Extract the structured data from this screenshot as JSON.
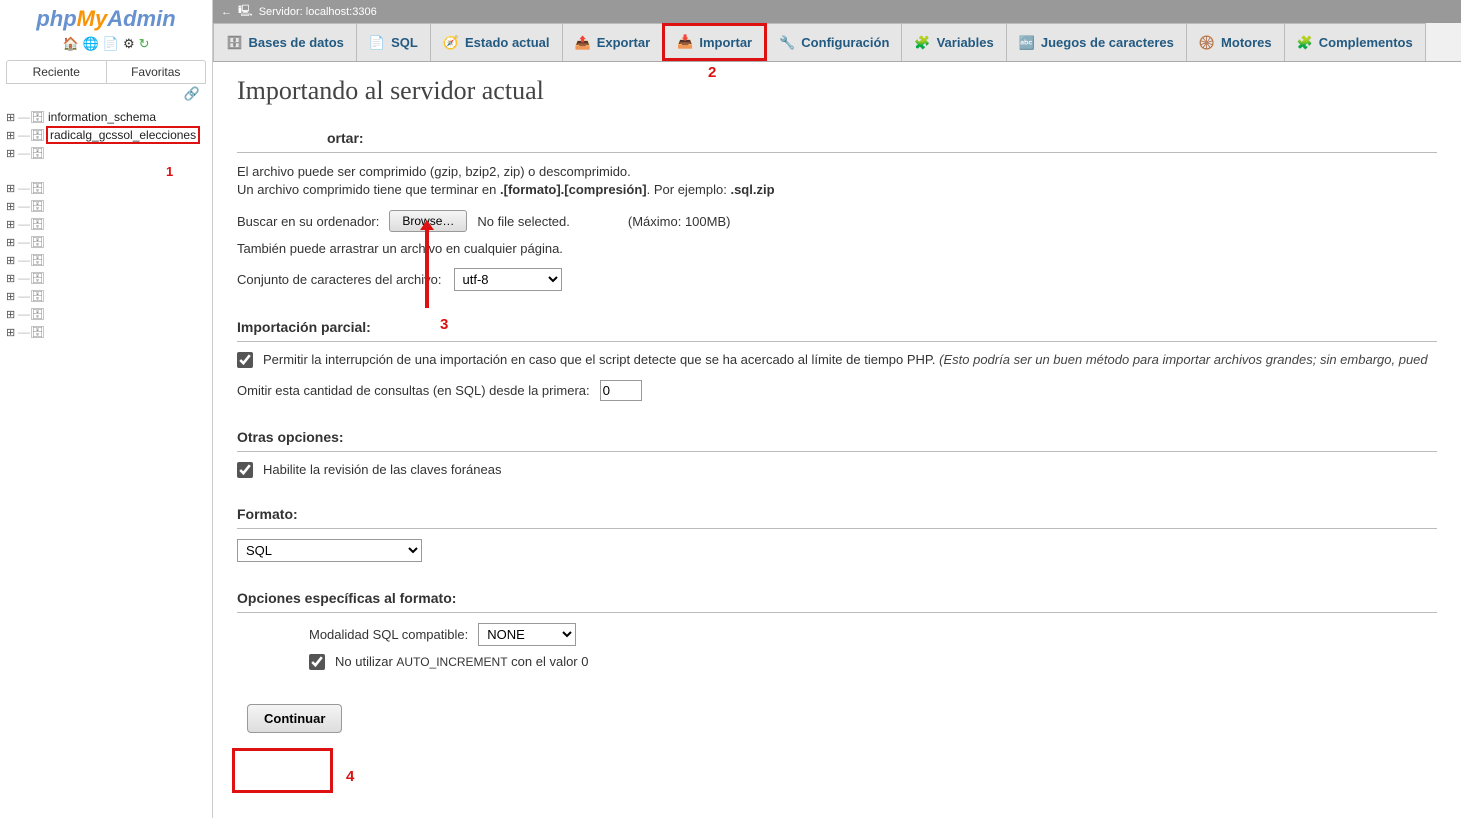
{
  "logo": {
    "p1": "php",
    "p2": "My",
    "p3": "Admin"
  },
  "sidebar_tabs": {
    "recent": "Reciente",
    "fav": "Favoritas"
  },
  "tree": {
    "db1": "information_schema",
    "db2": "radicalg_gcssol_elecciones"
  },
  "anno": {
    "one": "1",
    "two": "2",
    "three": "3",
    "four": "4"
  },
  "topbar": {
    "label": "Servidor: localhost:3306"
  },
  "tabs": {
    "databases": "Bases de datos",
    "sql": "SQL",
    "status": "Estado actual",
    "export": "Exportar",
    "import": "Importar",
    "settings": "Configuración",
    "variables": "Variables",
    "charsets": "Juegos de caracteres",
    "engines": "Motores",
    "plugins": "Complementos"
  },
  "title": "Importando al servidor actual",
  "import_section": {
    "heading_short": "ortar:",
    "desc1": "El archivo puede ser comprimido (gzip, bzip2, zip) o descomprimido.",
    "desc2a": "Un archivo comprimido tiene que terminar en ",
    "desc2b": ".[formato].[compresión]",
    "desc2c": ". Por ejemplo: ",
    "desc2d": ".sql.zip",
    "browse_label": "Buscar en su ordenador:",
    "browse_btn": "Browse…",
    "no_file": "No file selected.",
    "max": "(Máximo: 100MB)",
    "drag": "También puede arrastrar un archivo en cualquier página.",
    "charset_label": "Conjunto de caracteres del archivo:",
    "charset_value": "utf-8"
  },
  "partial": {
    "heading": "Importación parcial:",
    "allow_label": "Permitir la interrupción de una importación en caso que el script detecte que se ha acercado al límite de tiempo PHP.",
    "allow_note": "(Esto podría ser un buen método para importar archivos grandes; sin embargo, pued",
    "skip_label": "Omitir esta cantidad de consultas (en SQL) desde la primera:",
    "skip_value": "0"
  },
  "other": {
    "heading": "Otras opciones:",
    "fk_label": "Habilite la revisión de las claves foráneas"
  },
  "format": {
    "heading": "Formato:",
    "value": "SQL"
  },
  "format_opts": {
    "heading": "Opciones específicas al formato:",
    "compat_label": "Modalidad SQL compatible:",
    "compat_value": "NONE",
    "noauto_pre": "No utilizar ",
    "noauto_code": "AUTO_INCREMENT",
    "noauto_post": " con el valor 0"
  },
  "submit": {
    "label": "Continuar"
  }
}
